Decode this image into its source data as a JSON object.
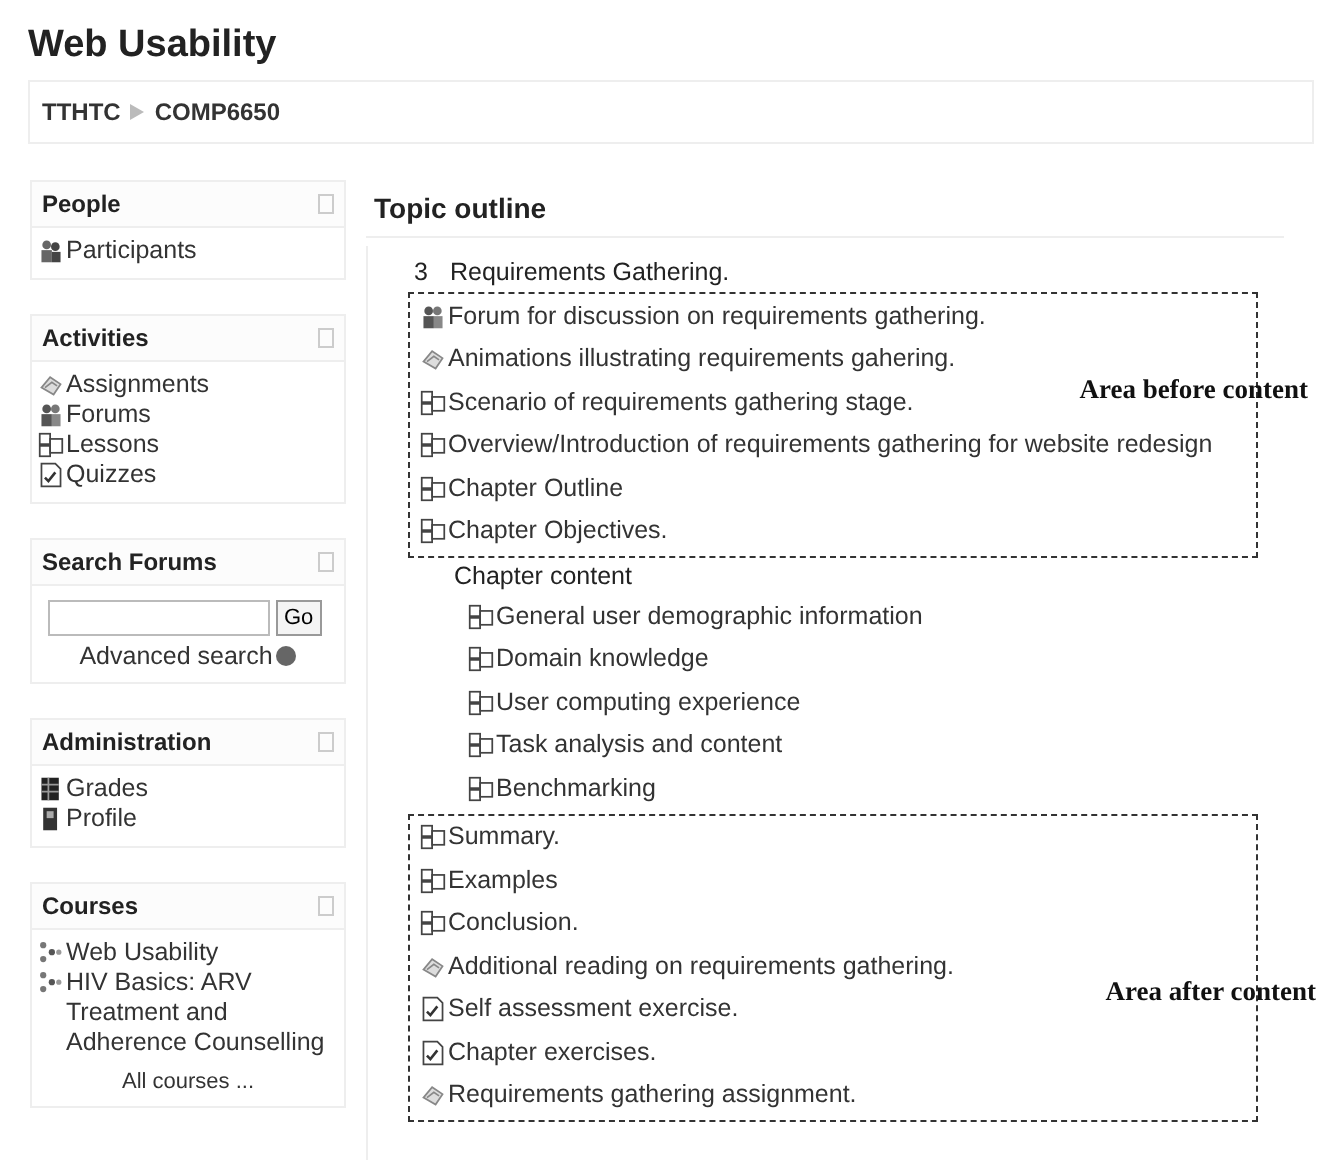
{
  "page": {
    "title": "Web Usability",
    "breadcrumb": [
      "TTHTC",
      "COMP6650"
    ]
  },
  "sidebar": [
    {
      "kind": "list",
      "title": "People",
      "items": [
        {
          "kind": "participants",
          "label": "Participants"
        }
      ]
    },
    {
      "kind": "list",
      "title": "Activities",
      "items": [
        {
          "kind": "assignment",
          "label": "Assignments"
        },
        {
          "kind": "forum",
          "label": "Forums"
        },
        {
          "kind": "resource",
          "label": "Lessons"
        },
        {
          "kind": "quiz",
          "label": "Quizzes"
        }
      ]
    },
    {
      "kind": "search",
      "title": "Search Forums",
      "button": "Go",
      "link": "Advanced search"
    },
    {
      "kind": "list",
      "title": "Administration",
      "items": [
        {
          "kind": "grades",
          "label": "Grades"
        },
        {
          "kind": "profile",
          "label": "Profile"
        }
      ]
    },
    {
      "kind": "list",
      "title": "Courses",
      "items": [
        {
          "kind": "course",
          "label": "Web Usability"
        },
        {
          "kind": "course",
          "label": "HIV Basics: ARV Treatment and Adherence Counselling"
        }
      ],
      "footer": "All courses ..."
    }
  ],
  "main": {
    "heading": "Topic outline",
    "section": {
      "number": "3",
      "title": "Requirements Gathering.",
      "groups": [
        {
          "kind": "annotated",
          "note": "Area before content",
          "items": [
            {
              "kind": "forum",
              "label": "Forum for discussion on requirements gathering."
            },
            {
              "kind": "assignment",
              "label": "Animations illustrating requirements gahering."
            },
            {
              "kind": "resource",
              "label": "Scenario of requirements gathering stage."
            },
            {
              "kind": "resource",
              "label": "Overview/Introduction of requirements gathering for website redesign"
            },
            {
              "kind": "resource",
              "label": "Chapter Outline"
            },
            {
              "kind": "resource",
              "label": "Chapter Objectives."
            }
          ]
        },
        {
          "kind": "subheading",
          "title": "Chapter content",
          "items": [
            {
              "kind": "resource",
              "label": "General user demographic information"
            },
            {
              "kind": "resource",
              "label": "Domain knowledge"
            },
            {
              "kind": "resource",
              "label": "User computing experience"
            },
            {
              "kind": "resource",
              "label": "Task analysis and content"
            },
            {
              "kind": "resource",
              "label": "Benchmarking"
            }
          ]
        },
        {
          "kind": "annotated",
          "note": "Area after content",
          "items": [
            {
              "kind": "resource",
              "label": "Summary."
            },
            {
              "kind": "resource",
              "label": "Examples"
            },
            {
              "kind": "resource",
              "label": "Conclusion."
            },
            {
              "kind": "assignment",
              "label": "Additional reading on requirements gathering."
            },
            {
              "kind": "quiz",
              "label": "Self assessment exercise."
            },
            {
              "kind": "quiz",
              "label": "Chapter exercises."
            },
            {
              "kind": "assignment",
              "label": "Requirements gathering assignment."
            }
          ]
        }
      ]
    }
  }
}
